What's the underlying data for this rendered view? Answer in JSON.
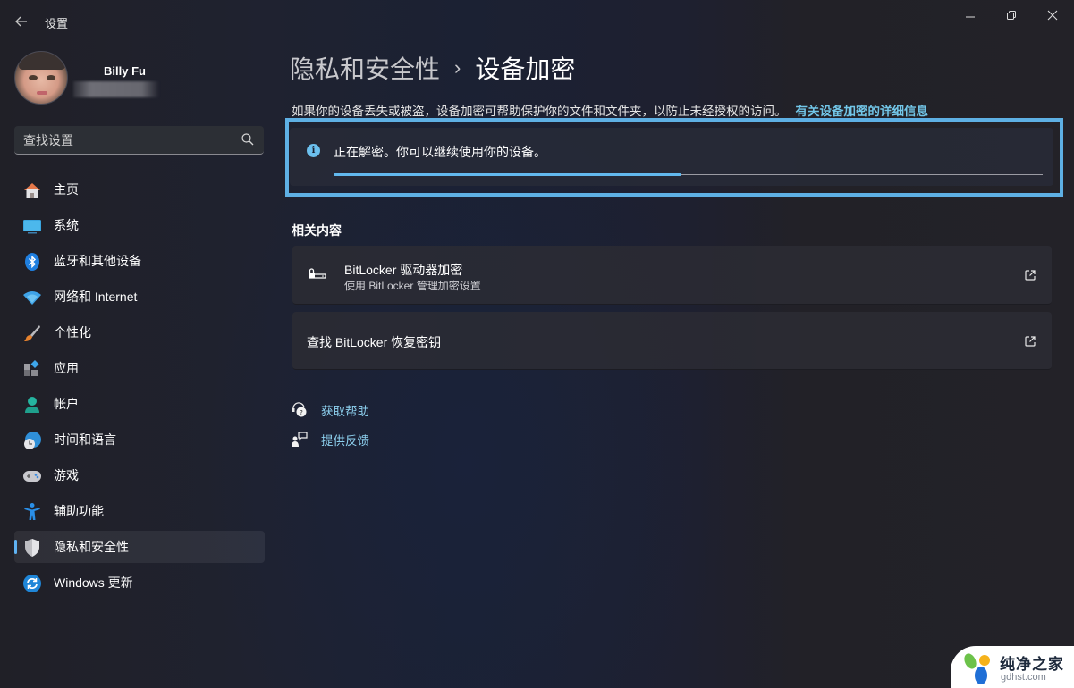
{
  "window": {
    "title": "设置",
    "controls": {
      "minimize": "minimize",
      "maximize": "restore",
      "close": "close"
    }
  },
  "profile": {
    "name": "Billy Fu",
    "email_redacted": true
  },
  "search": {
    "placeholder": "查找设置",
    "value": ""
  },
  "sidebar": {
    "items": [
      {
        "label": "主页",
        "icon": "home-icon",
        "active": false
      },
      {
        "label": "系统",
        "icon": "system-icon",
        "active": false
      },
      {
        "label": "蓝牙和其他设备",
        "icon": "bluetooth-icon",
        "active": false
      },
      {
        "label": "网络和 Internet",
        "icon": "network-icon",
        "active": false
      },
      {
        "label": "个性化",
        "icon": "brush-icon",
        "active": false
      },
      {
        "label": "应用",
        "icon": "apps-icon",
        "active": false
      },
      {
        "label": "帐户",
        "icon": "account-icon",
        "active": false
      },
      {
        "label": "时间和语言",
        "icon": "time-language-icon",
        "active": false
      },
      {
        "label": "游戏",
        "icon": "gamepad-icon",
        "active": false
      },
      {
        "label": "辅助功能",
        "icon": "accessibility-icon",
        "active": false
      },
      {
        "label": "隐私和安全性",
        "icon": "shield-icon",
        "active": true
      },
      {
        "label": "Windows 更新",
        "icon": "update-icon",
        "active": false
      }
    ]
  },
  "main": {
    "breadcrumb": {
      "parent": "隐私和安全性",
      "separator": "›",
      "current": "设备加密"
    },
    "description": "如果你的设备丢失或被盗，设备加密可帮助保护你的文件和文件夹，以防止未经授权的访问。",
    "learn_more_link": "有关设备加密的详细信息",
    "status": {
      "icon": "info-icon",
      "text": "正在解密。你可以继续使用你的设备。",
      "progress_percent": 49,
      "accent": "#62b8ee"
    },
    "related": {
      "title": "相关内容",
      "cards": [
        {
          "title": "BitLocker 驱动器加密",
          "subtitle": "使用 BitLocker 管理加密设置",
          "icon": "bitlocker-drive-icon",
          "action_icon": "external-link-icon"
        },
        {
          "title": "查找 BitLocker 恢复密钥",
          "subtitle": "",
          "action_icon": "external-link-icon"
        }
      ]
    },
    "links": [
      {
        "label": "获取帮助",
        "icon": "help-icon"
      },
      {
        "label": "提供反馈",
        "icon": "feedback-icon"
      }
    ]
  },
  "watermark": {
    "name": "纯净之家",
    "domain": "gdhst.com"
  }
}
